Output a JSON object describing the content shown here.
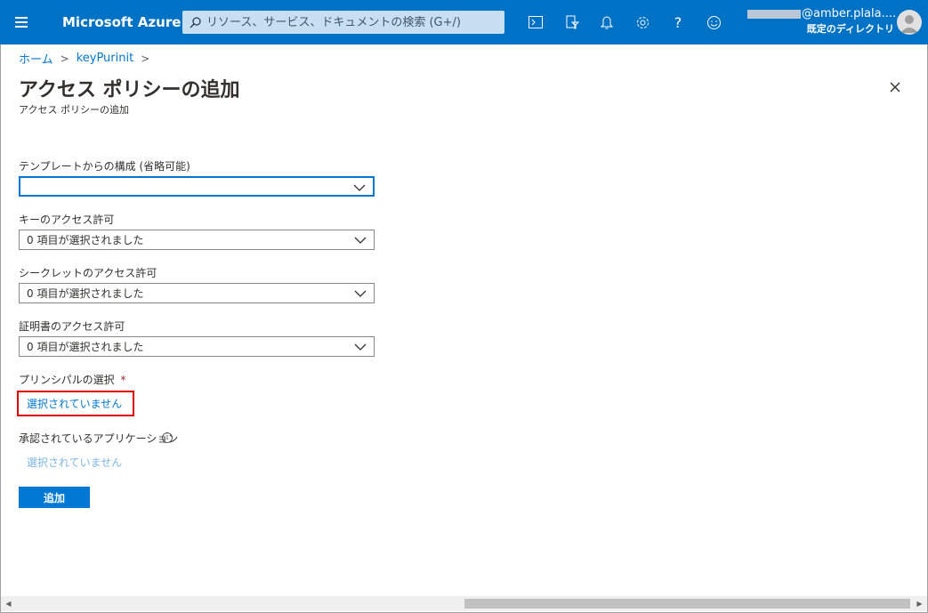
{
  "topbar": {
    "brand": "Microsoft Azure",
    "search_placeholder": "リソース、サービス、ドキュメントの検索 (G+/)",
    "icons": [
      "menu-icon",
      "cloud-shell-icon",
      "directory-filter-icon",
      "notifications-icon",
      "settings-icon",
      "help-icon",
      "feedback-icon"
    ],
    "account_email": "@amber.plala....",
    "account_directory": "既定のディレクトリ"
  },
  "breadcrumb": {
    "home": "ホーム",
    "sep": ">",
    "current": "keyPurinit",
    "sep2": ">"
  },
  "page": {
    "title": "アクセス ポリシーの追加",
    "subtitle": "アクセス ポリシーの追加"
  },
  "form": {
    "template_label": "テンプレートからの構成 (省略可能)",
    "template_value": "",
    "key_label": "キーのアクセス許可",
    "key_value": "0 項目が選択されました",
    "secret_label": "シークレットのアクセス許可",
    "secret_value": "0 項目が選択されました",
    "cert_label": "証明書のアクセス許可",
    "cert_value": "0 項目が選択されました",
    "principal_label": "プリンシパルの選択",
    "principal_required": "*",
    "principal_value": "選択されていません",
    "app_label": "承認されているアプリケーション",
    "app_value": "選択されていません",
    "add_button": "追加"
  },
  "colors": {
    "topbar": "#0072c6",
    "accent": "#0078d4",
    "highlight": "#e00000"
  }
}
